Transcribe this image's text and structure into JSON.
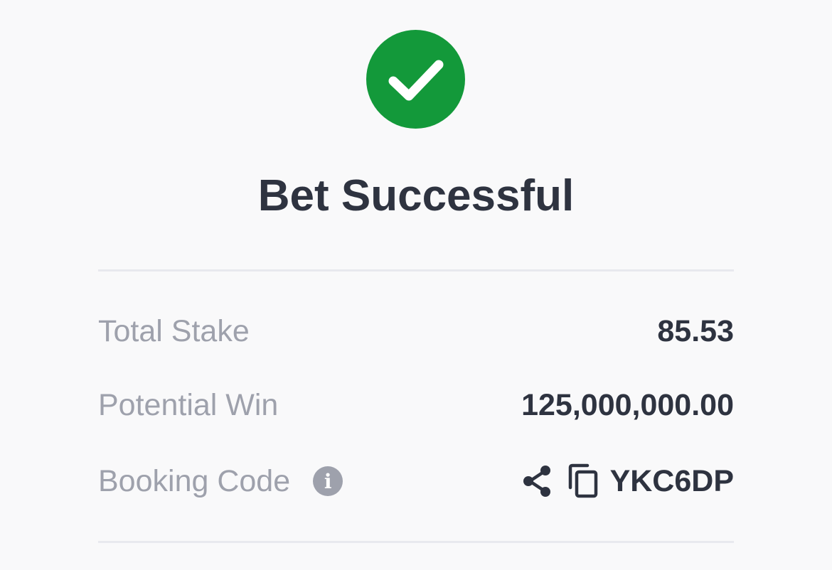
{
  "header": {
    "title": "Bet Successful",
    "icon": "check-circle-icon",
    "accent_color": "#13993a"
  },
  "summary": {
    "total_stake": {
      "label": "Total Stake",
      "value": "85.53"
    },
    "potential_win": {
      "label": "Potential Win",
      "value": "125,000,000.00"
    },
    "booking_code": {
      "label": "Booking Code",
      "info_icon": "info-icon",
      "share_icon": "share-icon",
      "copy_icon": "copy-icon",
      "value": "YKC6DP"
    }
  }
}
